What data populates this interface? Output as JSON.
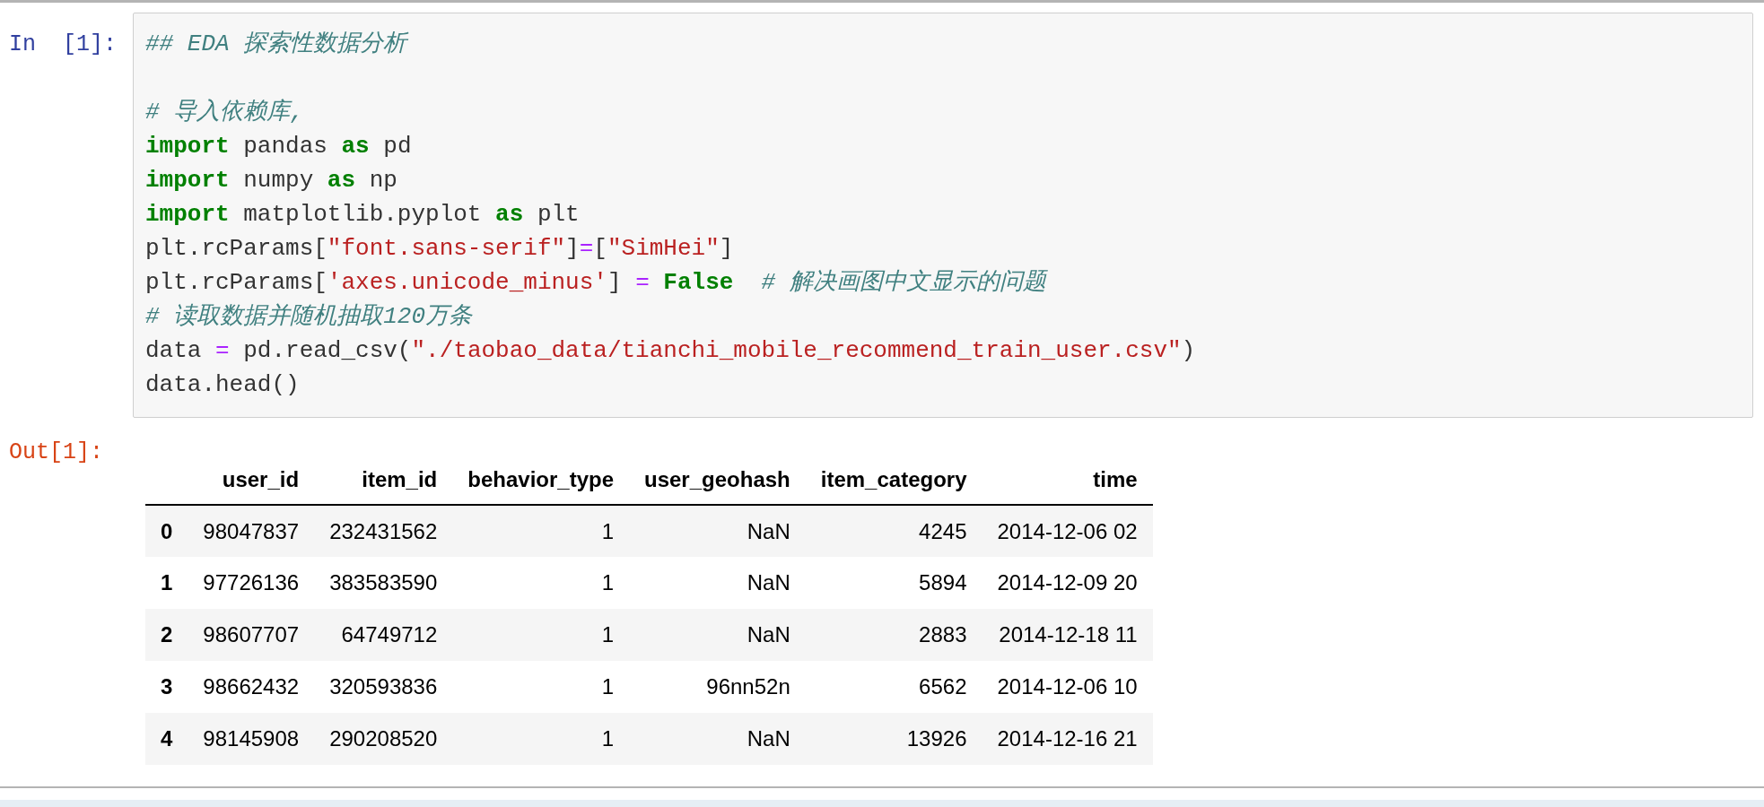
{
  "input_cell": {
    "prompt": "In  [1]:",
    "lines": [
      [
        {
          "kind": "comment",
          "text": "## EDA 探索性数据分析"
        }
      ],
      [
        {
          "kind": "comment",
          "text": "# 导入依赖库,"
        }
      ],
      [
        {
          "kind": "keyword",
          "text": "import"
        },
        {
          "kind": "plain",
          "text": " pandas "
        },
        {
          "kind": "keyword",
          "text": "as"
        },
        {
          "kind": "plain",
          "text": " pd"
        }
      ],
      [
        {
          "kind": "keyword",
          "text": "import"
        },
        {
          "kind": "plain",
          "text": " numpy "
        },
        {
          "kind": "keyword",
          "text": "as"
        },
        {
          "kind": "plain",
          "text": " np"
        }
      ],
      [
        {
          "kind": "keyword",
          "text": "import"
        },
        {
          "kind": "plain",
          "text": " matplotlib.pyplot "
        },
        {
          "kind": "keyword",
          "text": "as"
        },
        {
          "kind": "plain",
          "text": " plt"
        }
      ],
      [
        {
          "kind": "plain",
          "text": "plt.rcParams["
        },
        {
          "kind": "string",
          "text": "\"font.sans-serif\""
        },
        {
          "kind": "plain",
          "text": "]"
        },
        {
          "kind": "operator",
          "text": "="
        },
        {
          "kind": "plain",
          "text": "["
        },
        {
          "kind": "string",
          "text": "\"SimHei\""
        },
        {
          "kind": "plain",
          "text": "]"
        }
      ],
      [
        {
          "kind": "plain",
          "text": "plt.rcParams["
        },
        {
          "kind": "string",
          "text": "'axes.unicode_minus'"
        },
        {
          "kind": "plain",
          "text": "] "
        },
        {
          "kind": "operator",
          "text": "="
        },
        {
          "kind": "keyword",
          "text": " False"
        },
        {
          "kind": "comment",
          "text": "  # 解决画图中文显示的问题"
        }
      ],
      [
        {
          "kind": "comment",
          "text": "# 读取数据并随机抽取120万条"
        }
      ],
      [
        {
          "kind": "plain",
          "text": "data "
        },
        {
          "kind": "operator",
          "text": "="
        },
        {
          "kind": "plain",
          "text": " pd.read_csv("
        },
        {
          "kind": "string",
          "text": "\"./taobao_data/tianchi_mobile_recommend_train_user.csv\""
        },
        {
          "kind": "plain",
          "text": ")"
        }
      ],
      [
        {
          "kind": "plain",
          "text": "data.head()"
        }
      ]
    ]
  },
  "output_cell": {
    "prompt": "Out[1]:",
    "table": {
      "columns": [
        "user_id",
        "item_id",
        "behavior_type",
        "user_geohash",
        "item_category",
        "time"
      ],
      "rows": [
        {
          "index": "0",
          "cells": [
            "98047837",
            "232431562",
            "1",
            "NaN",
            "4245",
            "2014-12-06 02"
          ]
        },
        {
          "index": "1",
          "cells": [
            "97726136",
            "383583590",
            "1",
            "NaN",
            "5894",
            "2014-12-09 20"
          ]
        },
        {
          "index": "2",
          "cells": [
            "98607707",
            "64749712",
            "1",
            "NaN",
            "2883",
            "2014-12-18 11"
          ]
        },
        {
          "index": "3",
          "cells": [
            "98662432",
            "320593836",
            "1",
            "96nn52n",
            "6562",
            "2014-12-06 10"
          ]
        },
        {
          "index": "4",
          "cells": [
            "98145908",
            "290208520",
            "1",
            "NaN",
            "13926",
            "2014-12-16 21"
          ]
        }
      ]
    }
  }
}
